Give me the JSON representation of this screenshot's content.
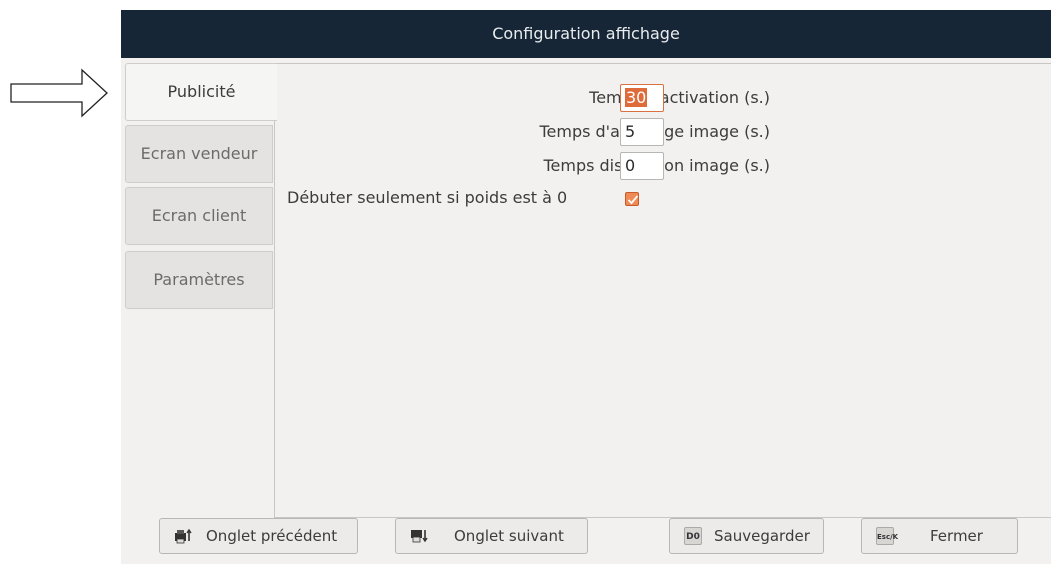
{
  "window": {
    "title": "Configuration affichage"
  },
  "tabs": [
    {
      "label": "Publicité",
      "active": true
    },
    {
      "label": "Ecran vendeur",
      "active": false
    },
    {
      "label": "Ecran client",
      "active": false
    },
    {
      "label": "Paramètres",
      "active": false
    }
  ],
  "form": {
    "activation": {
      "label": "Temps d'activation (s.)",
      "value": "30"
    },
    "display": {
      "label": "Temps d'affichage image (s.)",
      "value": "5"
    },
    "disappear": {
      "label": "Temps disparition image (s.)",
      "value": "0"
    },
    "start_zero": {
      "label": "Débuter seulement si poids est à 0",
      "checked": true
    }
  },
  "buttons": {
    "prev": {
      "label": "Onglet précédent",
      "icon": "printer-up-icon"
    },
    "next": {
      "label": "Onglet suivant",
      "icon": "printer-down-icon"
    },
    "save": {
      "label": "Sauvegarder",
      "key": "D0"
    },
    "close": {
      "label": "Fermer",
      "key": "Esc/K"
    }
  },
  "colors": {
    "titlebar": "#172636",
    "accent": "#e06b3a",
    "panel": "#f2f1f0"
  }
}
